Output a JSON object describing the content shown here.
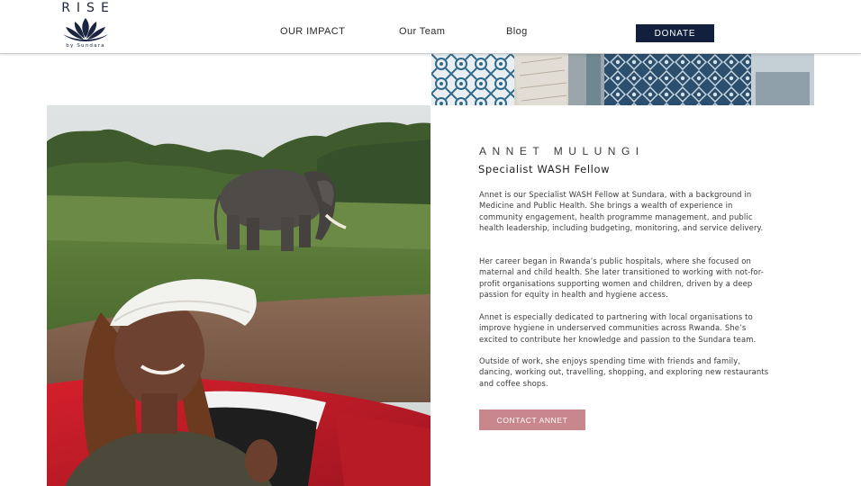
{
  "header": {
    "logo_word": "RISE",
    "logo_sub": "by Sundara",
    "nav": [
      "OUR IMPACT",
      "Our Team",
      "Blog"
    ],
    "donate_label": "DONATE"
  },
  "profile": {
    "name": "ANNET MULUNGI",
    "role": "Specialist WASH Fellow",
    "bio": [
      "Annet is our Specialist WASH Fellow at Sundara, with a background in Medicine and Public Health. She brings a wealth of experience in community engagement, health programme management, and public health leadership, including budgeting, monitoring, and service delivery.",
      "Her career began in Rwanda’s public hospitals, where she focused on maternal and child health. She later transitioned to working with not-for-profit organisations supporting women and children, driven by a deep passion for equity in health and hygiene access.",
      "Annet is especially dedicated to partnering with local organisations to improve hygiene in underserved communities across Rwanda. She’s excited to contribute her knowledge and passion to the Sundara team.",
      "Outside of work, she enjoys spending time with friends and family, dancing, working out, travelling, shopping, and exploring new restaurants and coffee shops."
    ],
    "contact_label": "CONTACT ANNET"
  },
  "colors": {
    "brand_navy": "#13203d",
    "contact_button": "#c7878c",
    "logo_lotus": "#1b2540"
  },
  "icons": [
    "lotus-logo-icon"
  ]
}
